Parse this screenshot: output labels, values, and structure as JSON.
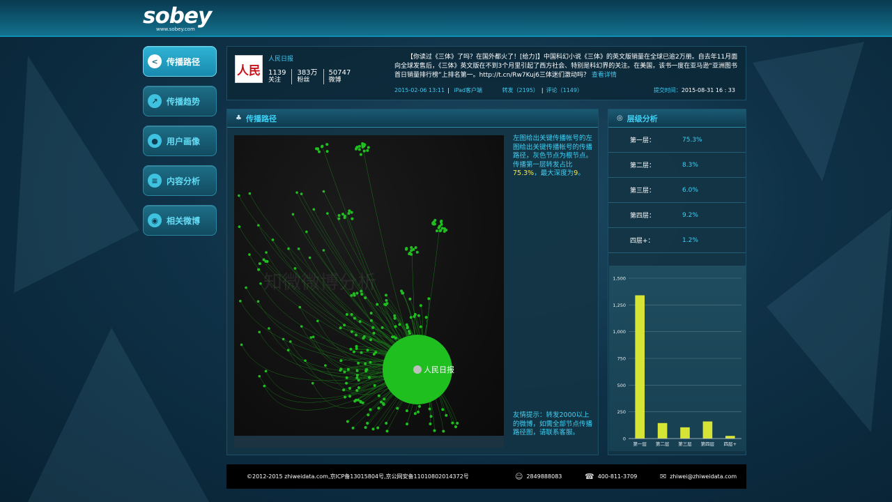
{
  "brand": {
    "logo_text": "sobey",
    "url": "www.sobey.com"
  },
  "sidebar": {
    "items": [
      {
        "label": "传播路径",
        "icon": "share-icon",
        "active": true
      },
      {
        "label": "传播趋势",
        "icon": "trend-icon",
        "active": false
      },
      {
        "label": "用户画像",
        "icon": "user-icon",
        "active": false
      },
      {
        "label": "内容分析",
        "icon": "document-icon",
        "active": false
      },
      {
        "label": "相关微博",
        "icon": "weibo-icon",
        "active": false
      }
    ]
  },
  "post": {
    "author": "人民日报",
    "avatar_text": "人民",
    "stats": [
      {
        "value": "1139",
        "label": "关注"
      },
      {
        "value": "383万",
        "label": "粉丝"
      },
      {
        "value": "50747",
        "label": "微博"
      }
    ],
    "text": "【你读过《三体》了吗？在国外都火了！[给力]】中国科幻小说《三体》的英文版销量在全球已逾2万册。自去年11月面向全球发售后，《三体》英文版在不到3个月里引起了西方社会、特别是科幻界的关注。在美国，该书一度在亚马逊“亚洲图书首日销量排行榜”上排名第一。http://t.cn/Rw7Kuj6三体迷们激动吗？",
    "more_label": "查看详情",
    "time": "2015-02-06 13:11",
    "source": "iPad客户端",
    "reposts": "转发（2195）",
    "comments": "评论（1149）",
    "submit_label": "提交时间：",
    "submit_time": "2015-08-31 16 : 33"
  },
  "path_panel": {
    "title": "传播路径",
    "watermark": "知微微博分析",
    "root_label": "人民日报",
    "desc_pre": "左图给出关键传播帐号的左图给出关键传播帐号的传播路径，灰色节点为根节点。传播第一层转发占比",
    "desc_pct": "75.3%",
    "desc_mid": "，最大深度为",
    "desc_depth": "9",
    "desc_post": "。",
    "tip": "友情提示：转发2000以上的微博，如需全部节点传播路径图，请联系客服。"
  },
  "level_panel": {
    "title": "层级分析",
    "rows": [
      {
        "name": "第一层：",
        "value": "75.3%"
      },
      {
        "name": "第二层：",
        "value": "8.3%"
      },
      {
        "name": "第三层：",
        "value": "6.0%"
      },
      {
        "name": "第四层：",
        "value": "9.2%"
      },
      {
        "name": "四层+：",
        "value": "1.2%"
      }
    ]
  },
  "chart_data": {
    "type": "bar",
    "categories": [
      "第一层",
      "第二层",
      "第三层",
      "第四层",
      "四层+"
    ],
    "values": [
      1340,
      145,
      105,
      160,
      25
    ],
    "ylim": [
      0,
      1500
    ],
    "yticks": [
      0,
      250,
      500,
      750,
      "1,000",
      "1,250",
      "1,500"
    ],
    "ytick_values": [
      0,
      250,
      500,
      750,
      1000,
      1250,
      1500
    ],
    "bar_color": "#d6e436",
    "grid": true
  },
  "footer": {
    "copyright": "©2012-2015 zhiweidata.com,京ICP备13015804号,京公网安备11010802014372号",
    "qq": "2849888083",
    "phone": "400-811-3709",
    "email": "zhiwei@zhiweidata.com"
  },
  "colors": {
    "accent": "#3fd0f5",
    "highlight": "#f5e84a",
    "graph_node": "#1fbf1f"
  }
}
